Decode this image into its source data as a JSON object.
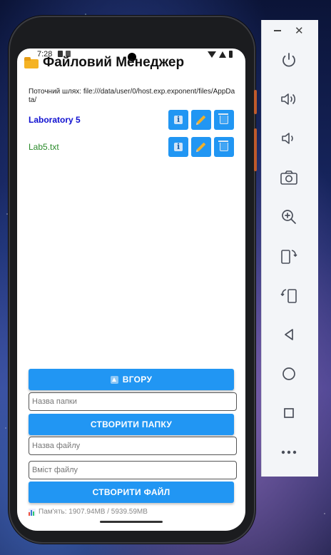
{
  "status": {
    "time": "7:28"
  },
  "app": {
    "title": "Файловий Менеджер"
  },
  "path": {
    "text": "Поточний шлях: file:///data/user/0/host.exp.exponent/files/AppData/"
  },
  "items": [
    {
      "name": "Laboratory 5",
      "kind": "folder"
    },
    {
      "name": "Lab5.txt",
      "kind": "file"
    }
  ],
  "actions": {
    "info_icon": "info-icon",
    "edit_icon": "pencil-icon",
    "delete_icon": "trash-icon"
  },
  "controls": {
    "up_label": "ВГОРУ",
    "folder_placeholder": "Назва папки",
    "create_folder_label": "СТВОРИТИ ПАПКУ",
    "file_placeholder": "Назва файлу",
    "content_placeholder": "Вміст файлу",
    "create_file_label": "СТВОРИТИ ФАЙЛ"
  },
  "memory": {
    "text": "Пам'ять: 1907.94MB / 5939.59MB"
  },
  "colors": {
    "accent": "#2196f3",
    "folder_text": "#1010d0",
    "file_text": "#2a8a2a"
  },
  "emulator": {
    "tools": [
      "power-icon",
      "volume-up-icon",
      "volume-down-icon",
      "camera-icon",
      "zoom-icon",
      "rotate-left-icon",
      "rotate-right-icon",
      "back-icon",
      "home-icon",
      "overview-icon",
      "more-icon"
    ]
  }
}
